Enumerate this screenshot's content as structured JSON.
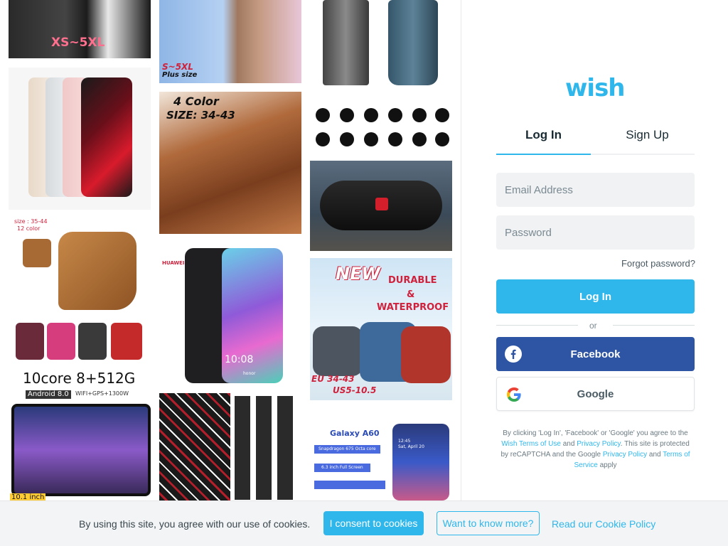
{
  "collage": {
    "tile1_size": "XS~5XL",
    "tile2_size": "S~5XL",
    "tile2_plus": "Plus size",
    "tile3_colors": "4 Color",
    "tile3_size": "SIZE: 34-43",
    "tile4_size": "size : 35-44",
    "tile4_colors": "12 color",
    "tile5_brand": "HUAWEI",
    "tile5_time": "10:08",
    "tile5_model": "honor",
    "tile6_new": "NEW",
    "tile6_durable": "DURABLE",
    "tile6_and": "&",
    "tile6_waterproof": "WATERPROOF",
    "tile6_eu": "EU 34-43",
    "tile6_us": "US5-10.5",
    "tile7_spec": "10core 8+512G",
    "tile7_os": "Android 8.0",
    "tile7_extra": "WIFI+GPS+1300W",
    "tile7_inch": "10.1 inch",
    "tile8_model": "Galaxy A60",
    "tile8_chip": "Snapdragon 675 Octa core",
    "tile8_screen": "6.3 inch   Full Screen",
    "tile8_time": "12:45",
    "tile8_date": "Sat, April 20"
  },
  "panel": {
    "logo": "wish",
    "tabs": [
      "Log In",
      "Sign Up"
    ],
    "email_placeholder": "Email Address",
    "password_placeholder": "Password",
    "forgot": "Forgot password?",
    "login_button": "Log In",
    "or": "or",
    "facebook_button": "Facebook",
    "google_button": "Google",
    "legal_1": "By clicking 'Log In', 'Facebook' or 'Google' you agree to the",
    "legal_terms": "Wish Terms of Use",
    "legal_and": "and",
    "legal_privacy": "Privacy Policy",
    "legal_2": ". This site is protected",
    "legal_3": "by reCAPTCHA and the Google",
    "legal_gprivacy": "Privacy Policy",
    "legal_and2": "and",
    "legal_gterms": "Terms of",
    "legal_service": "Service",
    "legal_apply": "apply"
  },
  "cookie": {
    "text": "By using this site, you agree with our use of cookies.",
    "consent": "I consent to cookies",
    "more": "Want to know more?",
    "policy": "Read our Cookie Policy"
  },
  "colors": {
    "brand": "#2fb7ec",
    "facebook": "#2d55a3",
    "text": "#192a32"
  }
}
